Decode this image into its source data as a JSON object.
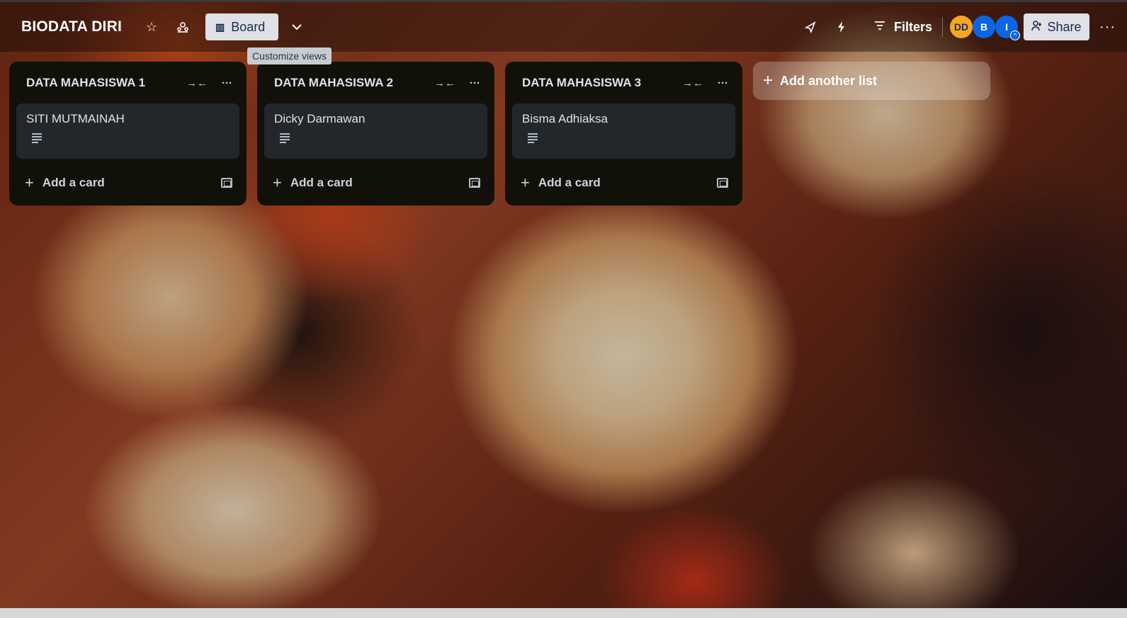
{
  "header": {
    "board_title": "BIODATA DIRI",
    "view_button": "Board",
    "filters": "Filters",
    "share": "Share",
    "tooltip": "Customize views",
    "members": [
      {
        "initials": "DD",
        "color": "#f5a623"
      },
      {
        "initials": "B",
        "color": "#0c66e4"
      },
      {
        "initials": "I",
        "color": "#0c66e4"
      }
    ]
  },
  "lists": [
    {
      "title": "DATA MAHASISWA 1",
      "cards": [
        {
          "title": "SITI MUTMAINAH",
          "has_description": true
        }
      ],
      "add_card": "Add a card"
    },
    {
      "title": "DATA MAHASISWA 2",
      "cards": [
        {
          "title": "Dicky Darmawan",
          "has_description": true
        }
      ],
      "add_card": "Add a card"
    },
    {
      "title": "DATA MAHASISWA 3",
      "cards": [
        {
          "title": "Bisma Adhiaksa",
          "has_description": true
        }
      ],
      "add_card": "Add a card"
    }
  ],
  "add_list": "Add another list",
  "colors": {
    "list_bg": "#111109",
    "card_bg": "#22272b",
    "button_bg": "#dfe1e6",
    "accent_blue": "#0c66e4"
  }
}
